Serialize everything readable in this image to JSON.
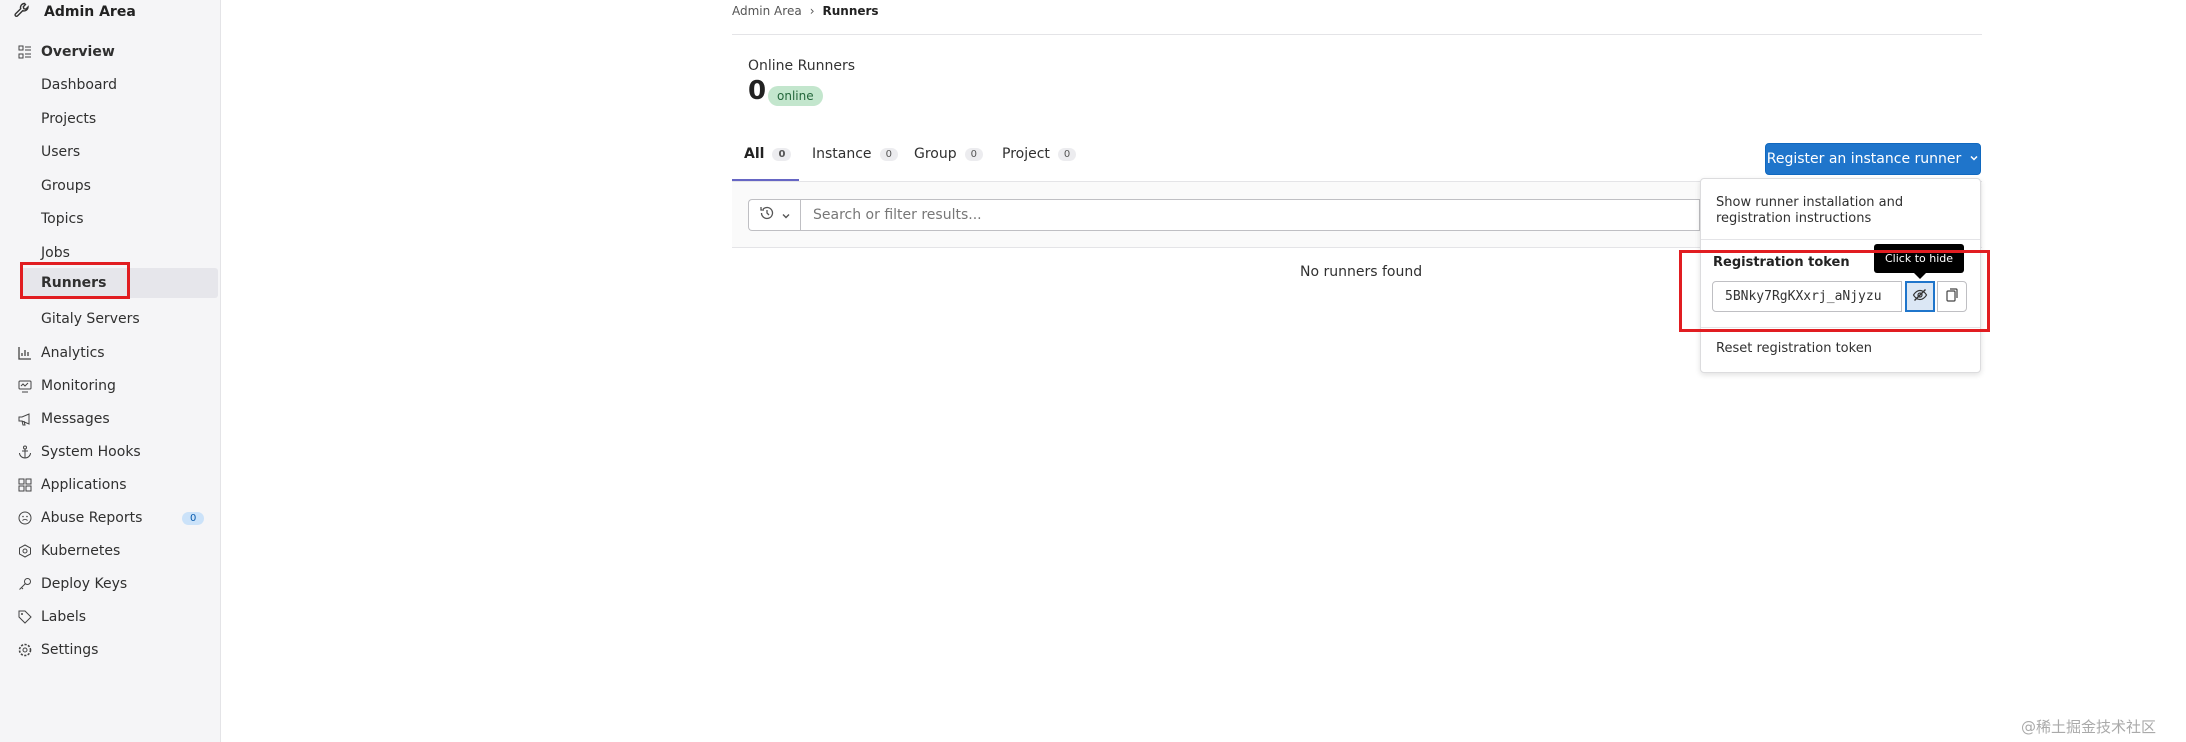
{
  "sidebar": {
    "title": "Admin Area",
    "sections": [
      {
        "label": "Overview",
        "icon": "overview-icon"
      },
      {
        "label": "Dashboard"
      },
      {
        "label": "Projects"
      },
      {
        "label": "Users"
      },
      {
        "label": "Groups"
      },
      {
        "label": "Topics"
      },
      {
        "label": "Jobs"
      },
      {
        "label": "Runners"
      },
      {
        "label": "Gitaly Servers"
      },
      {
        "label": "Analytics",
        "icon": "chart-icon"
      },
      {
        "label": "Monitoring",
        "icon": "monitor-icon"
      },
      {
        "label": "Messages",
        "icon": "megaphone-icon"
      },
      {
        "label": "System Hooks",
        "icon": "anchor-icon"
      },
      {
        "label": "Applications",
        "icon": "apps-icon"
      },
      {
        "label": "Abuse Reports",
        "icon": "abuse-icon",
        "badge": "0"
      },
      {
        "label": "Kubernetes",
        "icon": "kubernetes-icon"
      },
      {
        "label": "Deploy Keys",
        "icon": "key-icon"
      },
      {
        "label": "Labels",
        "icon": "label-icon"
      },
      {
        "label": "Settings",
        "icon": "settings-icon"
      }
    ]
  },
  "breadcrumb": {
    "parent": "Admin Area",
    "separator": "›",
    "current": "Runners"
  },
  "stats": {
    "label": "Online Runners",
    "value": "0",
    "badge": "online"
  },
  "tabs": [
    {
      "label": "All",
      "count": "0"
    },
    {
      "label": "Instance",
      "count": "0"
    },
    {
      "label": "Group",
      "count": "0"
    },
    {
      "label": "Project",
      "count": "0"
    }
  ],
  "search": {
    "placeholder": "Search or filter results..."
  },
  "empty": "No runners found",
  "register_button": "Register an instance runner",
  "dropdown": {
    "show_instructions": "Show runner installation and registration instructions",
    "token_title": "Registration token",
    "token_value": "5BNky7RgKXxrj_aNjyzu",
    "tooltip": "Click to hide",
    "reset": "Reset registration token"
  },
  "colors": {
    "accent": "#1f75cb",
    "highlight": "#e11d21",
    "active_tab": "#6666c4"
  },
  "watermark": "@稀土掘金技术社区"
}
